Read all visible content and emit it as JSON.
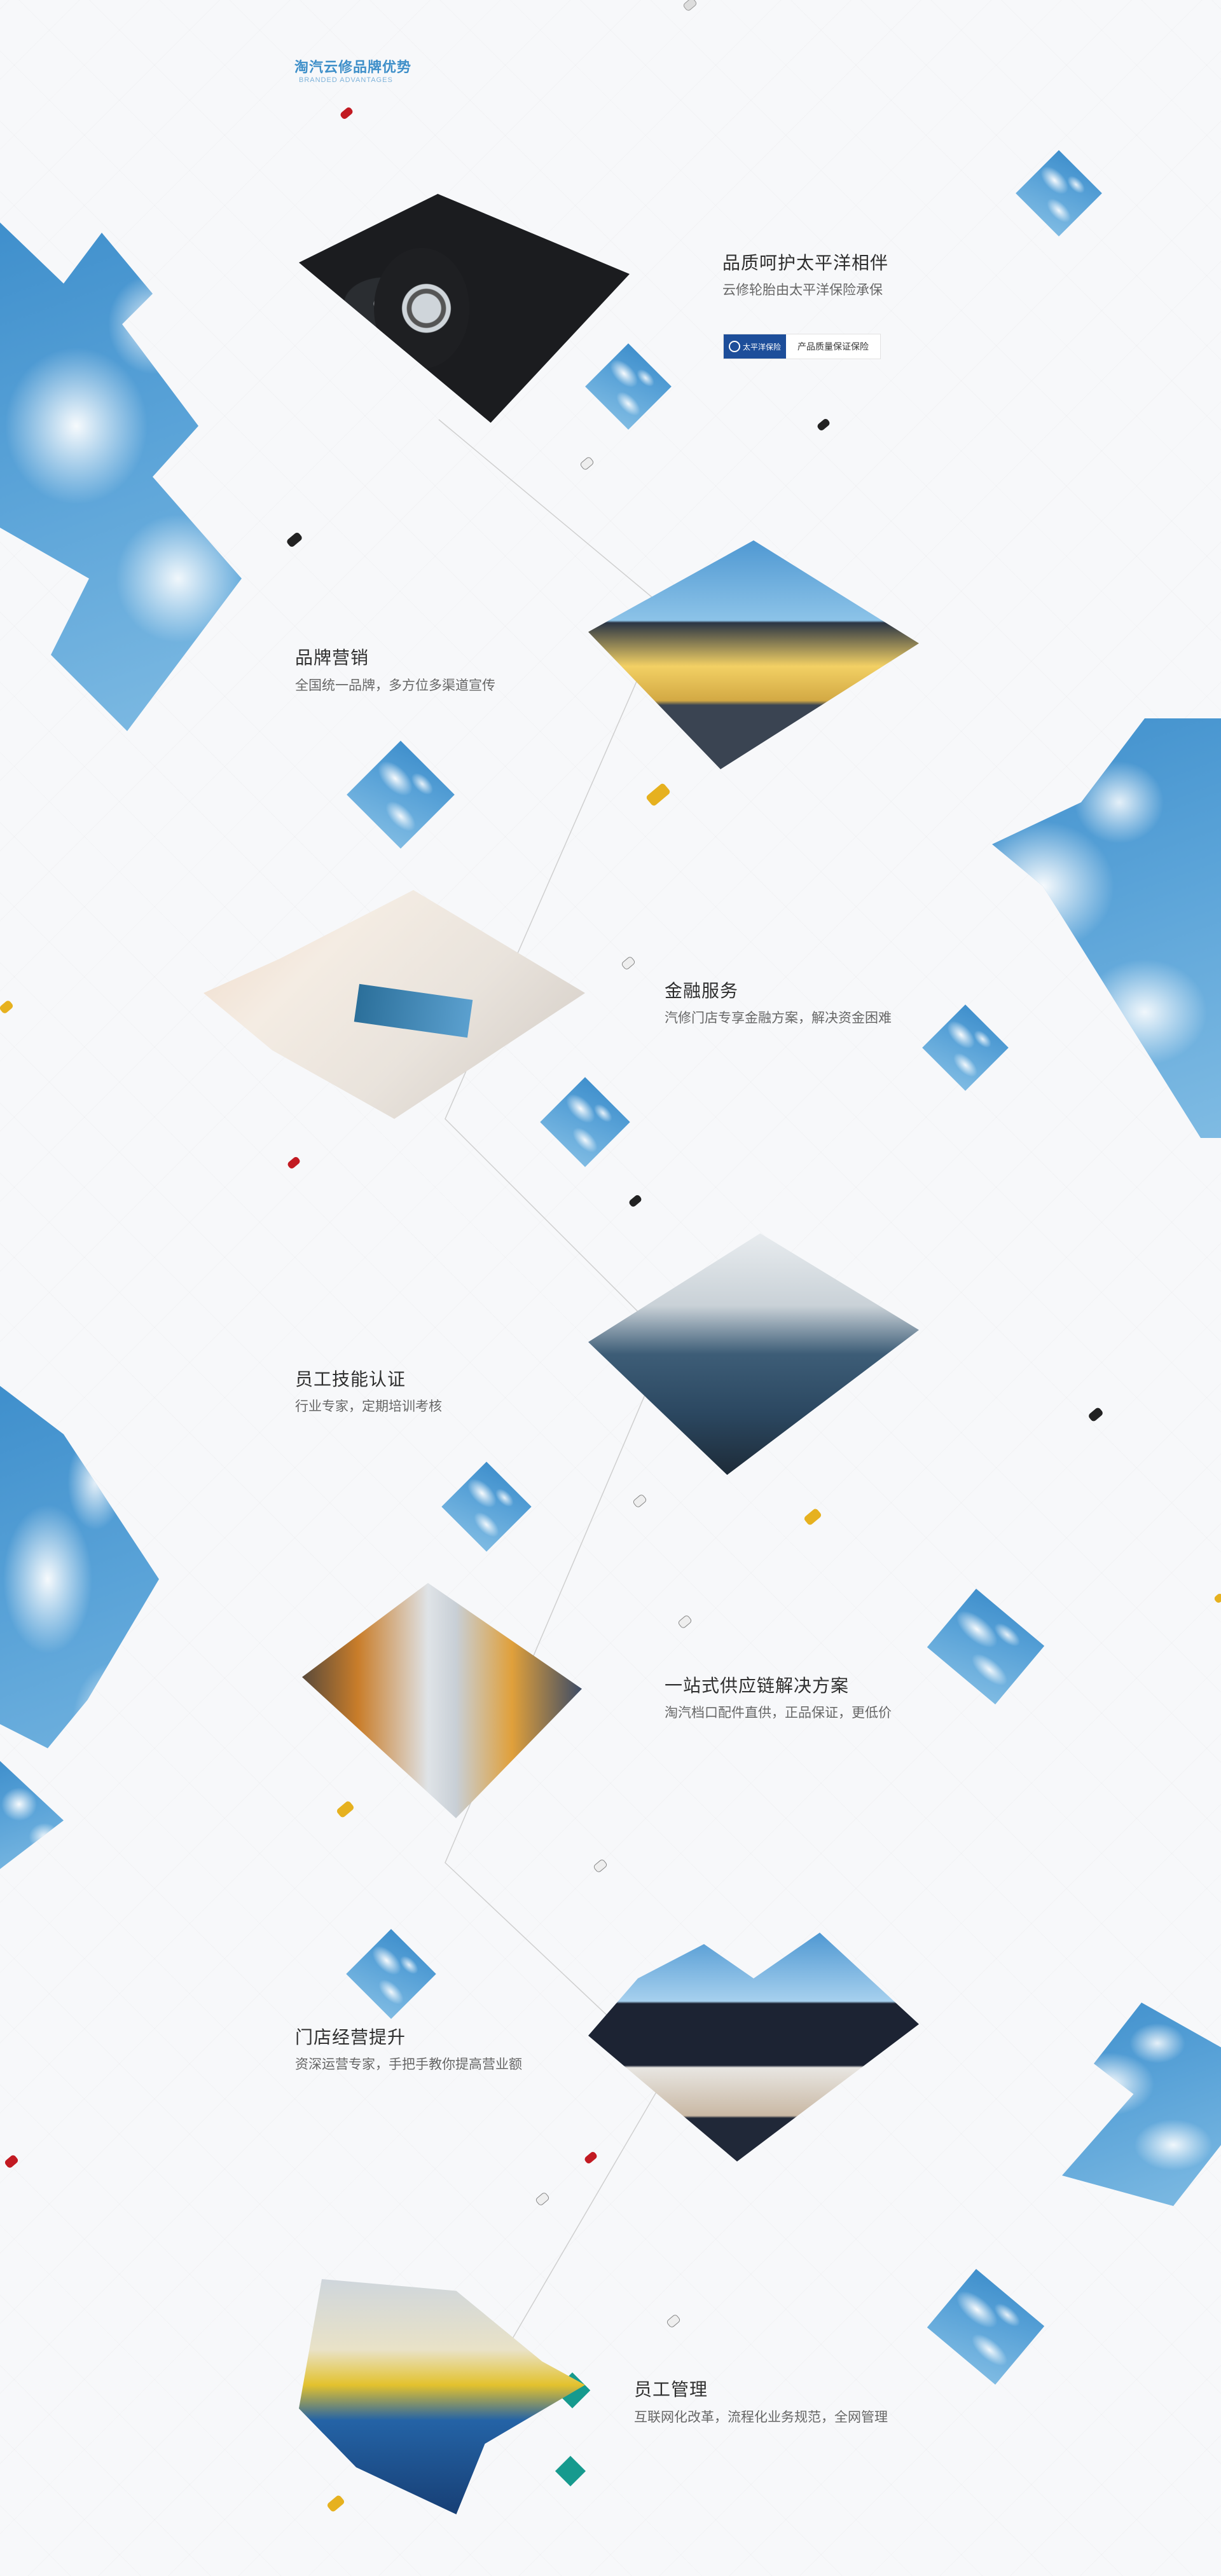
{
  "header": {
    "title": "淘汽云修品牌优势",
    "subtitle": "BRANDED ADVANTAGES"
  },
  "features": [
    {
      "title": "品质呵护太平洋相伴",
      "desc": "云修轮胎由太平洋保险承保"
    },
    {
      "title": "品牌营销",
      "desc": "全国统一品牌，多方位多渠道宣传"
    },
    {
      "title": "金融服务",
      "desc": "汽修门店专享金融方案，解决资金困难"
    },
    {
      "title": "员工技能认证",
      "desc": "行业专家，定期培训考核"
    },
    {
      "title": "一站式供应链解决方案",
      "desc": "淘汽档口配件直供，正品保证，更低价"
    },
    {
      "title": "门店经营提升",
      "desc": "资深运营专家，手把手教你提高营业额"
    },
    {
      "title": "员工管理",
      "desc": "互联网化改革，流程化业务规范，全网管理"
    }
  ],
  "badge": {
    "logo_text": "太平洋保险",
    "label": "产品质量保证保险"
  },
  "colors": {
    "accent": "#3e8fc9",
    "sky": "#4a96d0",
    "teal": "#169a8e",
    "line": "#cfcfcf"
  },
  "icons": [
    "tire-photo",
    "store-photo",
    "credit-card-photo",
    "mechanic-photo",
    "warehouse-photo",
    "storefront-photo",
    "workers-photo",
    "toy-car-icon"
  ]
}
